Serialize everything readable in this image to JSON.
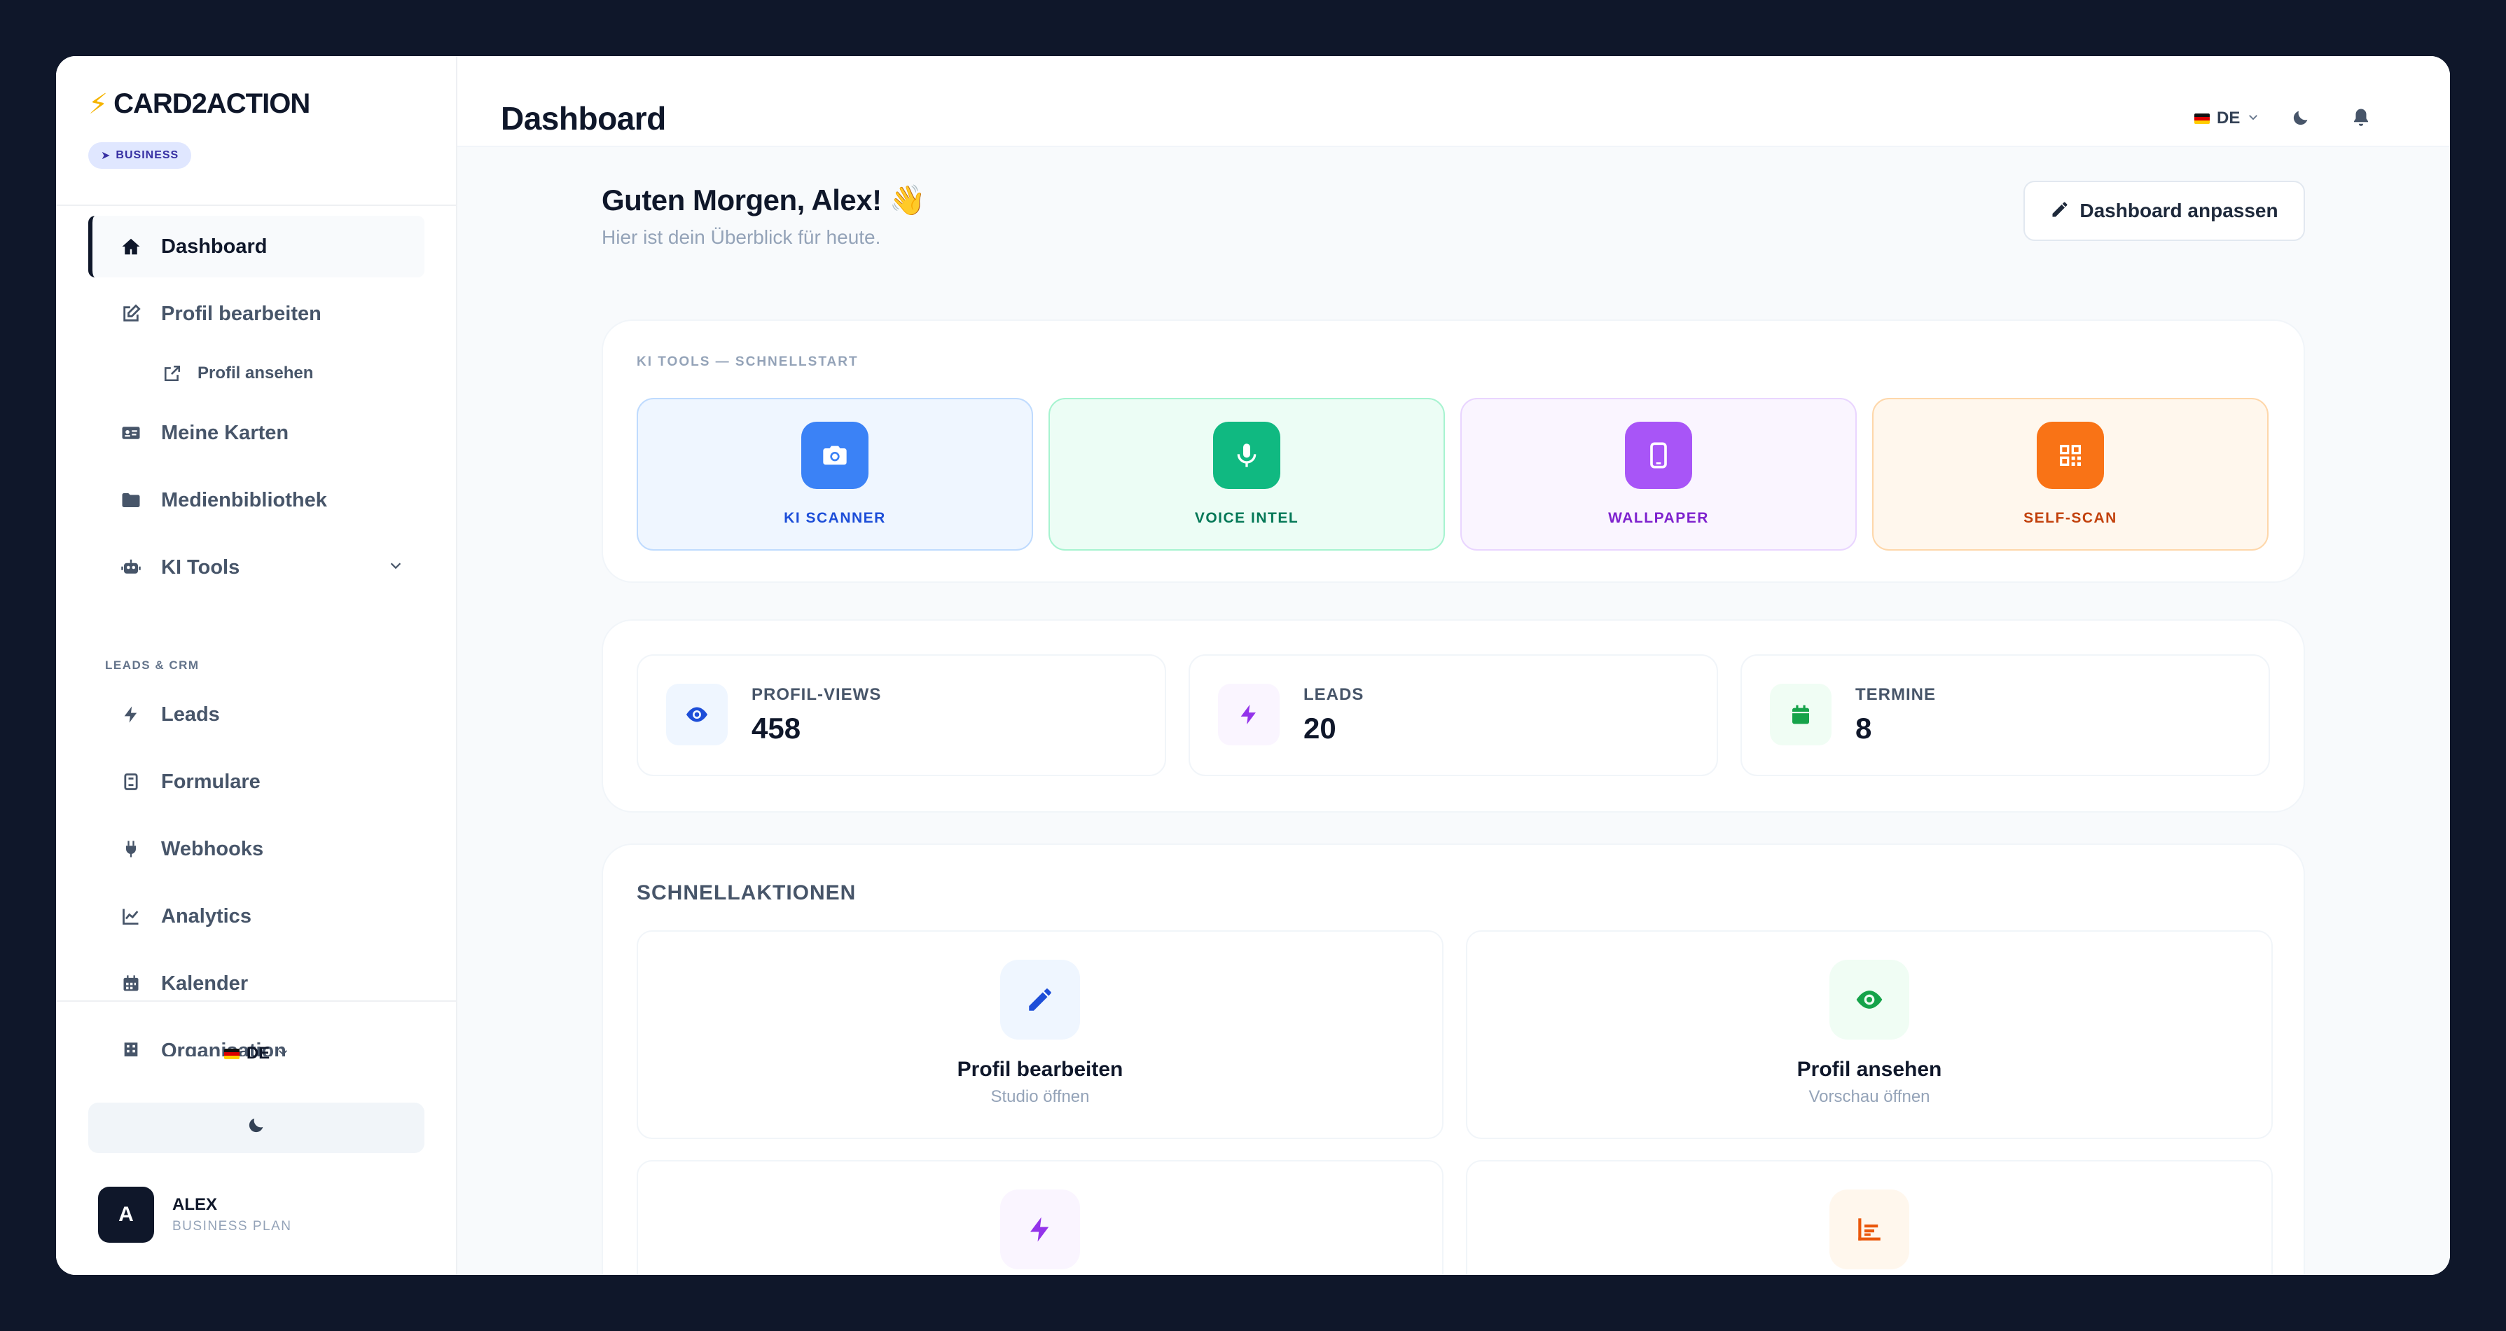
{
  "brand": {
    "name": "CARD2ACTION",
    "plan_badge": "BUSINESS"
  },
  "sidebar": {
    "items": [
      {
        "label": "Dashboard",
        "icon": "home-icon",
        "active": true
      },
      {
        "label": "Profil bearbeiten",
        "icon": "edit-icon"
      },
      {
        "label": "Profil ansehen",
        "icon": "external-link-icon"
      },
      {
        "label": "Meine Karten",
        "icon": "id-card-icon"
      },
      {
        "label": "Medienbibliothek",
        "icon": "folder-icon"
      },
      {
        "label": "KI Tools",
        "icon": "robot-icon"
      },
      {
        "label": "Leads",
        "icon": "bolt-icon"
      },
      {
        "label": "Formulare",
        "icon": "form-icon"
      },
      {
        "label": "Webhooks",
        "icon": "plug-icon"
      },
      {
        "label": "Analytics",
        "icon": "chart-line-icon"
      },
      {
        "label": "Kalender",
        "icon": "calendar-icon"
      },
      {
        "label": "Organisation",
        "icon": "building-icon"
      }
    ],
    "section_leads": "LEADS & CRM",
    "language": "DE"
  },
  "user": {
    "name": "ALEX",
    "plan": "BUSINESS PLAN",
    "initial": "A"
  },
  "topbar": {
    "title": "Dashboard",
    "language": "DE"
  },
  "greeting": {
    "title": "Guten Morgen, Alex! 👋",
    "subtitle": "Hier ist dein Überblick für heute."
  },
  "customize_button": "Dashboard anpassen",
  "ki_tools": {
    "heading": "KI TOOLS — SCHNELLSTART",
    "tools": [
      {
        "label": "KI SCANNER",
        "icon": "camera-icon",
        "color": "#3b82f6"
      },
      {
        "label": "VOICE INTEL",
        "icon": "microphone-icon",
        "color": "#10b981"
      },
      {
        "label": "WALLPAPER",
        "icon": "phone-icon",
        "color": "#a855f7"
      },
      {
        "label": "SELF-SCAN",
        "icon": "qr-code-icon",
        "color": "#f97316"
      }
    ]
  },
  "stats": [
    {
      "label": "PROFIL-VIEWS",
      "value": "458",
      "icon": "eye-icon"
    },
    {
      "label": "LEADS",
      "value": "20",
      "icon": "bolt-icon"
    },
    {
      "label": "TERMINE",
      "value": "8",
      "icon": "calendar-icon"
    }
  ],
  "quick_actions": {
    "heading": "SCHNELLAKTIONEN",
    "items": [
      {
        "title": "Profil bearbeiten",
        "subtitle": "Studio öffnen",
        "icon": "pencil-icon"
      },
      {
        "title": "Profil ansehen",
        "subtitle": "Vorschau öffnen",
        "icon": "eye-icon"
      },
      {
        "icon": "bolt-icon"
      },
      {
        "icon": "bar-chart-icon"
      }
    ]
  }
}
